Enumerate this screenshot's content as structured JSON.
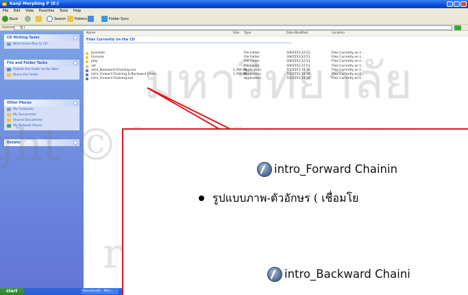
{
  "window": {
    "title": "Kanji Morphing P (E:)"
  },
  "menu": [
    "File",
    "Edit",
    "View",
    "Favorites",
    "Tools",
    "Help"
  ],
  "toolbar": {
    "back": "Back",
    "search": "Search",
    "folders": "Folders",
    "folder_sync": "Folder Sync"
  },
  "address": {
    "label": "Address",
    "value": "E:\\"
  },
  "sidebar": {
    "cd_tasks": {
      "title": "CD Writing Tasks",
      "items": [
        "Write these files to CD"
      ]
    },
    "file_tasks": {
      "title": "File and Folder Tasks",
      "items": [
        "Publish this folder to the Web",
        "Share this folder"
      ]
    },
    "other_places": {
      "title": "Other Places",
      "items": [
        "My Computer",
        "My Documents",
        "Shared Documents",
        "My Network Places"
      ]
    },
    "details": {
      "title": "Details"
    }
  },
  "columns": [
    "Name",
    "Size",
    "Type",
    "Date Modified",
    "Location"
  ],
  "group_title": "Files Currently on the CD",
  "files": [
    {
      "name": "bconsole",
      "size": "",
      "type": "File Folder",
      "date": "3/9/2553 22:51",
      "location": "Files Currently on t..."
    },
    {
      "name": "fconsole",
      "size": "",
      "type": "File Folder",
      "date": "3/9/2553 22:51",
      "location": "Files Currently on t..."
    },
    {
      "name": "play",
      "size": "",
      "type": "File Folder",
      "date": "3/9/2553 22:51",
      "location": "Files Currently on t..."
    },
    {
      "name": "set",
      "size": "",
      "type": "File Folder",
      "date": "3/9/2553 22:51",
      "location": "Files Currently on t..."
    },
    {
      "name": "intro_Backward Chaining.exe",
      "size": "1,766 KB",
      "type": "Application",
      "date": "7/2/2553 19:36",
      "location": "Files Currently on t..."
    },
    {
      "name": "intro_Forward Chaining & Backward Chain...",
      "size": "1,766 KB",
      "type": "Application",
      "date": "7/2/2553 19:36",
      "location": "Files Currently on t..."
    },
    {
      "name": "intro_Forward Chaining.exe",
      "size": "",
      "type": "Application",
      "date": "7/2/2553 19:36",
      "location": "Files Currently on t..."
    }
  ],
  "taskbar": {
    "start": "start",
    "item": "Document1 - Micr..."
  },
  "callout": {
    "forward_label": "intro_Forward Chainin",
    "bullet_text": "รูปแบบภาพ-ตัวอักษร ( เชื่อมโย",
    "backward_label": "intro_Backward Chaini"
  },
  "watermark": [
    "มหาวิทยาลัย",
    "ght © by Chiang Ma",
    "r i g h t s   r e s"
  ],
  "colors": {
    "callout_border": "#e0141e",
    "xp_blue": "#0a4fd6",
    "sidebar": "#6f8fe0"
  }
}
